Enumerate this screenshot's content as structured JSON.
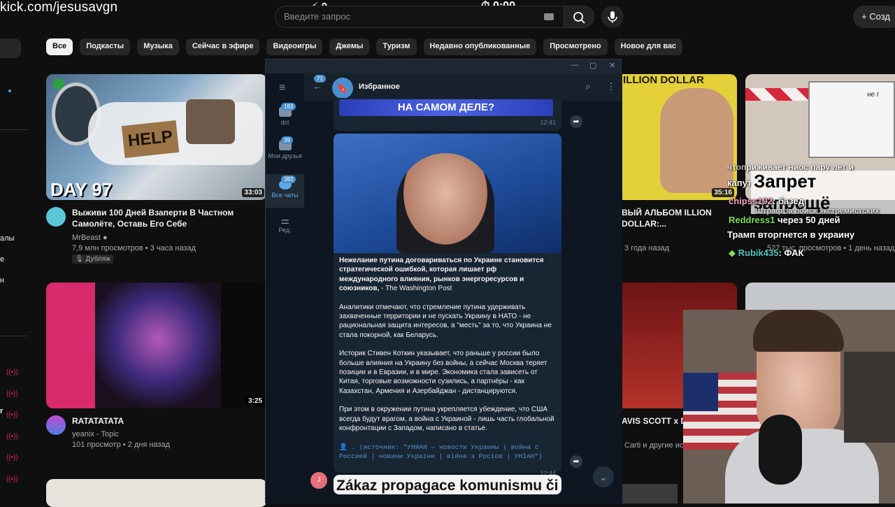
{
  "overlay": {
    "url": "kick.com/jesusavgn",
    "coins": "0",
    "timer": "0:00"
  },
  "youtube": {
    "search_placeholder": "Введите запрос",
    "create_label": "Созд",
    "chips": [
      "Все",
      "Подкасты",
      "Музыка",
      "Сейчас в эфире",
      "Видеоигры",
      "Джемы",
      "Туризм",
      "Недавно опубликованные",
      "Просмотрено",
      "Новое для вас"
    ],
    "sidebar_fragments": [
      "алы",
      "е",
      "н"
    ],
    "videos": [
      {
        "title": "Выживи 100 Дней Взаперти В Частном Самолёте, Оставь Его Себе",
        "channel": "MrBeast",
        "meta": "7,9 млн просмотров • 3 часа назад",
        "badge": "Дубляж",
        "duration": "33:03",
        "thumb_text": "DAY 97",
        "thumb_sign": "HELP"
      },
      {
        "title": "RATATATATA",
        "channel": "yeanix - Topic",
        "meta": "101 просмотр • 2 дня назад",
        "duration": "3:25"
      },
      {
        "title": "ВЫЙ АЛЬБОМ ILLION DOLLAR:...",
        "meta": "3 года назад",
        "duration": "35:16",
        "thumb_text": "ILLION DOLLAR"
      },
      {
        "title": "AVIS SCOTT x DR",
        "meta": "Carti и другие исп"
      },
      {
        "meta": "527 тыс. просмотров • 1 день назад",
        "thumb_text": "не г"
      }
    ]
  },
  "telegram": {
    "chat_name": "Избранное",
    "back_badge": "71",
    "folders": [
      {
        "label": "dct",
        "badge": "183"
      },
      {
        "label": "Мои друзья",
        "badge": "39"
      },
      {
        "label": "Все чаты",
        "badge": "383"
      },
      {
        "label": "Ред."
      }
    ],
    "prev_image_text": "НА САМОМ ДЕЛЕ?",
    "prev_time": "12:41",
    "post_headline": "Нежелание путина договариваться по Украине становится стратегической ошибкой, которая лишает рф международного влияния, рынков энергоресурсов и союзников,",
    "post_source_inline": " - The Washington Post",
    "post_p2": "Аналитики отмечают, что стремление путина удерживать захваченные территории и не пускать Украину в НАТО - не рациональная защита интересов, а \"месть\" за то, что Украина не стала покорной, как Беларусь.",
    "post_p3": "Историк Стивен Коткин указывает, что раньше у россии было больше влияния на Украину без войны, а сейчас Москва теряет позиции и в Евразии, и в мире. Экономика стала зависеть от Китая, торговые возможности сузились, а партнёры - как Казахстан, Армения и Азербайджан - дистанцируются.",
    "post_p4": "При этом в окружении путина укрепляется убеждение, что США всегда будут врагом, а война с Украиной - лишь часть глобальной конфронтации с Западом, написано в статье.",
    "post_source": "👤 . (источник: \"УНИАН — новости Украины | война с Россией | новини України | війна з Росією | УНІАН\")",
    "post_time": "12:44",
    "next_text": "Zákaz propagace komunismu či",
    "avatar_letter": "J"
  },
  "stream_chat": [
    {
      "user": "",
      "text": "чтоприживает ниос пару лет и"
    },
    {
      "user": "",
      "text": "капут"
    },
    {
      "user": "",
      "text": "Запрет запрещё"
    },
    {
      "user": "chipss192",
      "text": ": базед"
    },
    {
      "user": "",
      "text": "Штраф за поиск экстремистских"
    },
    {
      "user": "Reddress1",
      "text": "через 50 дней"
    },
    {
      "user": "",
      "text": "Трамп вторгнется в украину"
    },
    {
      "user": "Rubik435",
      "text": ": ФАК"
    }
  ],
  "colors": {
    "accent": "#4a8fcd",
    "yt_bg": "#0f0f0f",
    "tg_bg": "#17212b",
    "chip_bg": "#272727",
    "live_red": "#e0245e"
  }
}
